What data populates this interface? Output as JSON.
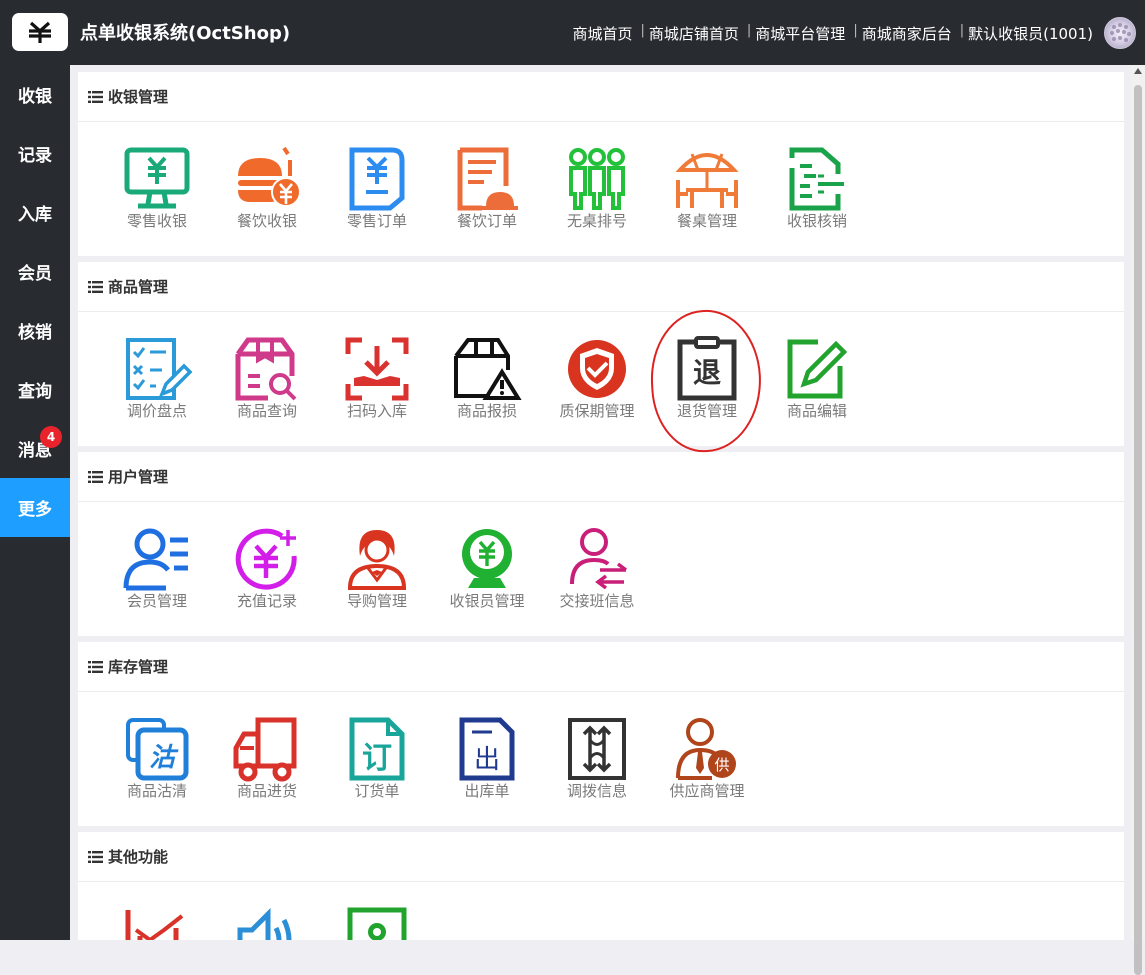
{
  "header": {
    "app_title": "点单收银系统(OctShop)",
    "nav": [
      "商城首页",
      "商城店铺首页",
      "商城平台管理",
      "商城商家后台",
      "默认收银员(1001)"
    ],
    "separator": "|",
    "logo_icon": "yuan-sign-icon"
  },
  "sidebar": {
    "items": [
      {
        "label": "收银"
      },
      {
        "label": "记录"
      },
      {
        "label": "入库"
      },
      {
        "label": "会员"
      },
      {
        "label": "核销"
      },
      {
        "label": "查询"
      },
      {
        "label": "消息",
        "badge": "4"
      },
      {
        "label": "更多",
        "active": true
      }
    ],
    "active_color": "#1e9fff",
    "badge_color": "#e8232b"
  },
  "sections": [
    {
      "title": "收银管理",
      "tiles": [
        {
          "label": "零售收银",
          "icon": "monitor-yuan-icon",
          "color": "#1aaa7a"
        },
        {
          "label": "餐饮收银",
          "icon": "burger-yuan-icon",
          "color": "#f06a2b"
        },
        {
          "label": "零售订单",
          "icon": "yuan-document-icon",
          "color": "#2d8cf0"
        },
        {
          "label": "餐饮订单",
          "icon": "order-list-icon",
          "color": "#ec6d3a"
        },
        {
          "label": "无桌排号",
          "icon": "people-queue-icon",
          "color": "#23c13a"
        },
        {
          "label": "餐桌管理",
          "icon": "table-umbrella-icon",
          "color": "#f07a37"
        },
        {
          "label": "收银核销",
          "icon": "verify-scan-icon",
          "color": "#1aa34a"
        }
      ]
    },
    {
      "title": "商品管理",
      "tiles": [
        {
          "label": "调价盘点",
          "icon": "checklist-pencil-icon",
          "color": "#2b9ad8"
        },
        {
          "label": "商品查询",
          "icon": "box-search-icon",
          "color": "#d03a8a"
        },
        {
          "label": "扫码入库",
          "icon": "scan-in-icon",
          "color": "#d9322f"
        },
        {
          "label": "商品报损",
          "icon": "box-warning-icon",
          "color": "#111111"
        },
        {
          "label": "质保期管理",
          "icon": "shield-check-icon",
          "color": "#d8341f"
        },
        {
          "label": "退货管理",
          "icon": "return-clipboard-icon",
          "color": "#333333",
          "glyph": "退"
        },
        {
          "label": "商品编辑",
          "icon": "edit-pencil-icon",
          "color": "#22a32e"
        }
      ]
    },
    {
      "title": "用户管理",
      "tiles": [
        {
          "label": "会员管理",
          "icon": "member-list-icon",
          "color": "#1f6fe0"
        },
        {
          "label": "充值记录",
          "icon": "recharge-yuan-icon",
          "color": "#d21ee8"
        },
        {
          "label": "导购管理",
          "icon": "shopping-guide-icon",
          "color": "#d8341f"
        },
        {
          "label": "收银员管理",
          "icon": "cashier-icon",
          "color": "#20b032"
        },
        {
          "label": "交接班信息",
          "icon": "user-swap-icon",
          "color": "#c91f79"
        }
      ]
    },
    {
      "title": "库存管理",
      "tiles": [
        {
          "label": "商品沽清",
          "icon": "sold-out-icon",
          "color": "#1f7fd9",
          "glyph": "沽"
        },
        {
          "label": "商品进货",
          "icon": "truck-icon",
          "color": "#d8322a"
        },
        {
          "label": "订货单",
          "icon": "order-doc-icon",
          "color": "#1aa59a",
          "glyph": "订"
        },
        {
          "label": "出库单",
          "icon": "outbound-doc-icon",
          "color": "#1f3a8f",
          "glyph": "出"
        },
        {
          "label": "调拨信息",
          "icon": "transfer-arrows-icon",
          "color": "#333333"
        },
        {
          "label": "供应商管理",
          "icon": "supplier-icon",
          "color": "#b0441a",
          "glyph": "供"
        }
      ]
    },
    {
      "title": "其他功能",
      "tiles": [
        {
          "label": "",
          "icon": "chart-bars-icon",
          "color": "#d8322a"
        },
        {
          "label": "",
          "icon": "speaker-icon",
          "color": "#2b8fd8"
        },
        {
          "label": "",
          "icon": "settings-gear-icon",
          "color": "#22a32e"
        }
      ]
    }
  ]
}
